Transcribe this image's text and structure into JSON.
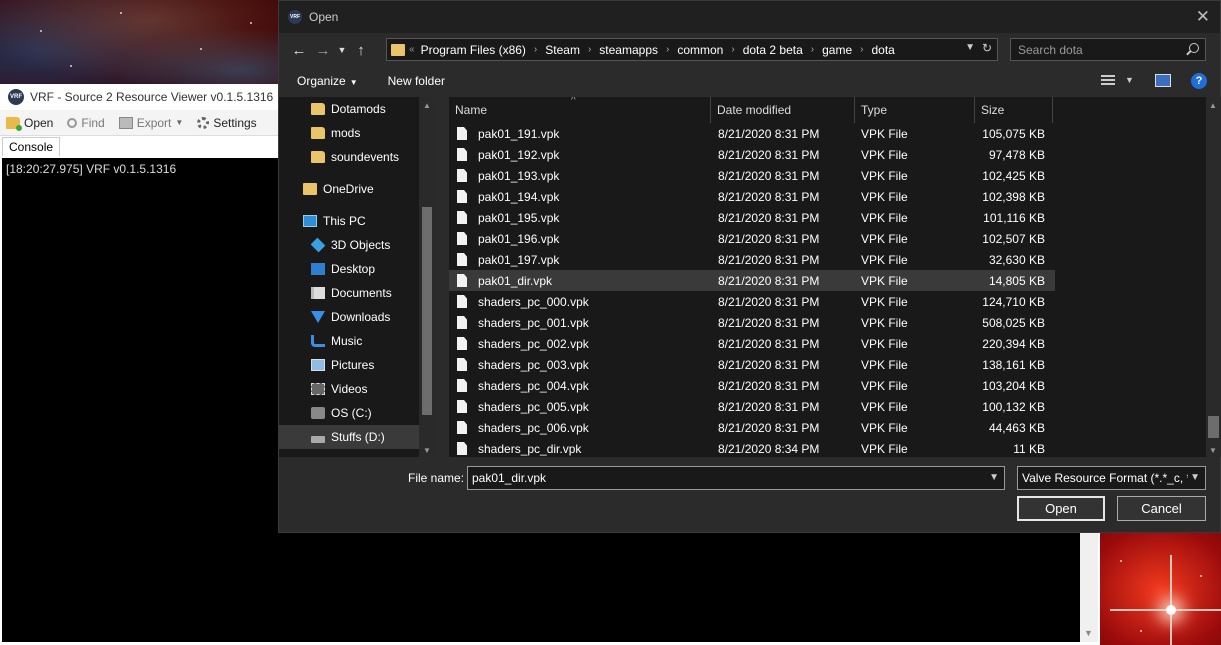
{
  "vrf_window": {
    "title": "VRF - Source 2 Resource Viewer v0.1.5.1316",
    "logo_text": "VRF",
    "toolbar": {
      "open_label": "Open",
      "find_label": "Find",
      "export_label": "Export",
      "settings_label": "Settings"
    },
    "tab_label": "Console",
    "console_line": "[18:20:27.975] VRF v0.1.5.1316"
  },
  "dialog": {
    "title": "Open",
    "address": {
      "overflow_marker": "«",
      "crumbs": [
        "Program Files (x86)",
        "Steam",
        "steamapps",
        "common",
        "dota 2 beta",
        "game",
        "dota"
      ],
      "separator": "›"
    },
    "search_placeholder": "Search dota",
    "commands": {
      "organize_label": "Organize",
      "new_folder_label": "New folder",
      "help_label": "?"
    },
    "nav_items": [
      {
        "label": "Dotamods",
        "icon": "folder-icon",
        "indent": 2
      },
      {
        "label": "mods",
        "icon": "folder-icon",
        "indent": 2
      },
      {
        "label": "soundevents",
        "icon": "folder-icon",
        "indent": 2
      },
      {
        "label": "OneDrive",
        "icon": "onedrive-icon",
        "indent": 1
      },
      {
        "label": "This PC",
        "icon": "computer-icon",
        "indent": 1
      },
      {
        "label": "3D Objects",
        "icon": "cube-icon",
        "indent": 2
      },
      {
        "label": "Desktop",
        "icon": "desktop-icon",
        "indent": 2
      },
      {
        "label": "Documents",
        "icon": "documents-icon",
        "indent": 2
      },
      {
        "label": "Downloads",
        "icon": "download-arrow-icon",
        "indent": 2
      },
      {
        "label": "Music",
        "icon": "music-note-icon",
        "indent": 2
      },
      {
        "label": "Pictures",
        "icon": "pictures-icon",
        "indent": 2
      },
      {
        "label": "Videos",
        "icon": "video-icon",
        "indent": 2
      },
      {
        "label": "OS (C:)",
        "icon": "drive-icon",
        "indent": 2
      },
      {
        "label": "Stuffs (D:)",
        "icon": "drive-icon",
        "indent": 2,
        "selected": true
      }
    ],
    "columns": {
      "name": "Name",
      "date": "Date modified",
      "type": "Type",
      "size": "Size"
    },
    "files": [
      {
        "name": "pak01_191.vpk",
        "date": "8/21/2020 8:31 PM",
        "type": "VPK File",
        "size": "105,075 KB"
      },
      {
        "name": "pak01_192.vpk",
        "date": "8/21/2020 8:31 PM",
        "type": "VPK File",
        "size": "97,478 KB"
      },
      {
        "name": "pak01_193.vpk",
        "date": "8/21/2020 8:31 PM",
        "type": "VPK File",
        "size": "102,425 KB"
      },
      {
        "name": "pak01_194.vpk",
        "date": "8/21/2020 8:31 PM",
        "type": "VPK File",
        "size": "102,398 KB"
      },
      {
        "name": "pak01_195.vpk",
        "date": "8/21/2020 8:31 PM",
        "type": "VPK File",
        "size": "101,116 KB"
      },
      {
        "name": "pak01_196.vpk",
        "date": "8/21/2020 8:31 PM",
        "type": "VPK File",
        "size": "102,507 KB"
      },
      {
        "name": "pak01_197.vpk",
        "date": "8/21/2020 8:31 PM",
        "type": "VPK File",
        "size": "32,630 KB"
      },
      {
        "name": "pak01_dir.vpk",
        "date": "8/21/2020 8:31 PM",
        "type": "VPK File",
        "size": "14,805 KB",
        "selected": true
      },
      {
        "name": "shaders_pc_000.vpk",
        "date": "8/21/2020 8:31 PM",
        "type": "VPK File",
        "size": "124,710 KB"
      },
      {
        "name": "shaders_pc_001.vpk",
        "date": "8/21/2020 8:31 PM",
        "type": "VPK File",
        "size": "508,025 KB"
      },
      {
        "name": "shaders_pc_002.vpk",
        "date": "8/21/2020 8:31 PM",
        "type": "VPK File",
        "size": "220,394 KB"
      },
      {
        "name": "shaders_pc_003.vpk",
        "date": "8/21/2020 8:31 PM",
        "type": "VPK File",
        "size": "138,161 KB"
      },
      {
        "name": "shaders_pc_004.vpk",
        "date": "8/21/2020 8:31 PM",
        "type": "VPK File",
        "size": "103,204 KB"
      },
      {
        "name": "shaders_pc_005.vpk",
        "date": "8/21/2020 8:31 PM",
        "type": "VPK File",
        "size": "100,132 KB"
      },
      {
        "name": "shaders_pc_006.vpk",
        "date": "8/21/2020 8:31 PM",
        "type": "VPK File",
        "size": "44,463 KB"
      },
      {
        "name": "shaders_pc_dir.vpk",
        "date": "8/21/2020 8:34 PM",
        "type": "VPK File",
        "size": "11 KB"
      }
    ],
    "file_name_label": "File name:",
    "file_name_value": "pak01_dir.vpk",
    "filter_value": "Valve Resource Format (*.*_c, *.",
    "open_button": "Open",
    "cancel_button": "Cancel"
  },
  "colors": {
    "dialog_bg": "#2b2b2b",
    "pane_bg": "#191919",
    "selection": "#3a3a3a",
    "accent_blue": "#1e6fd9",
    "folder_yellow": "#e9c46a"
  }
}
